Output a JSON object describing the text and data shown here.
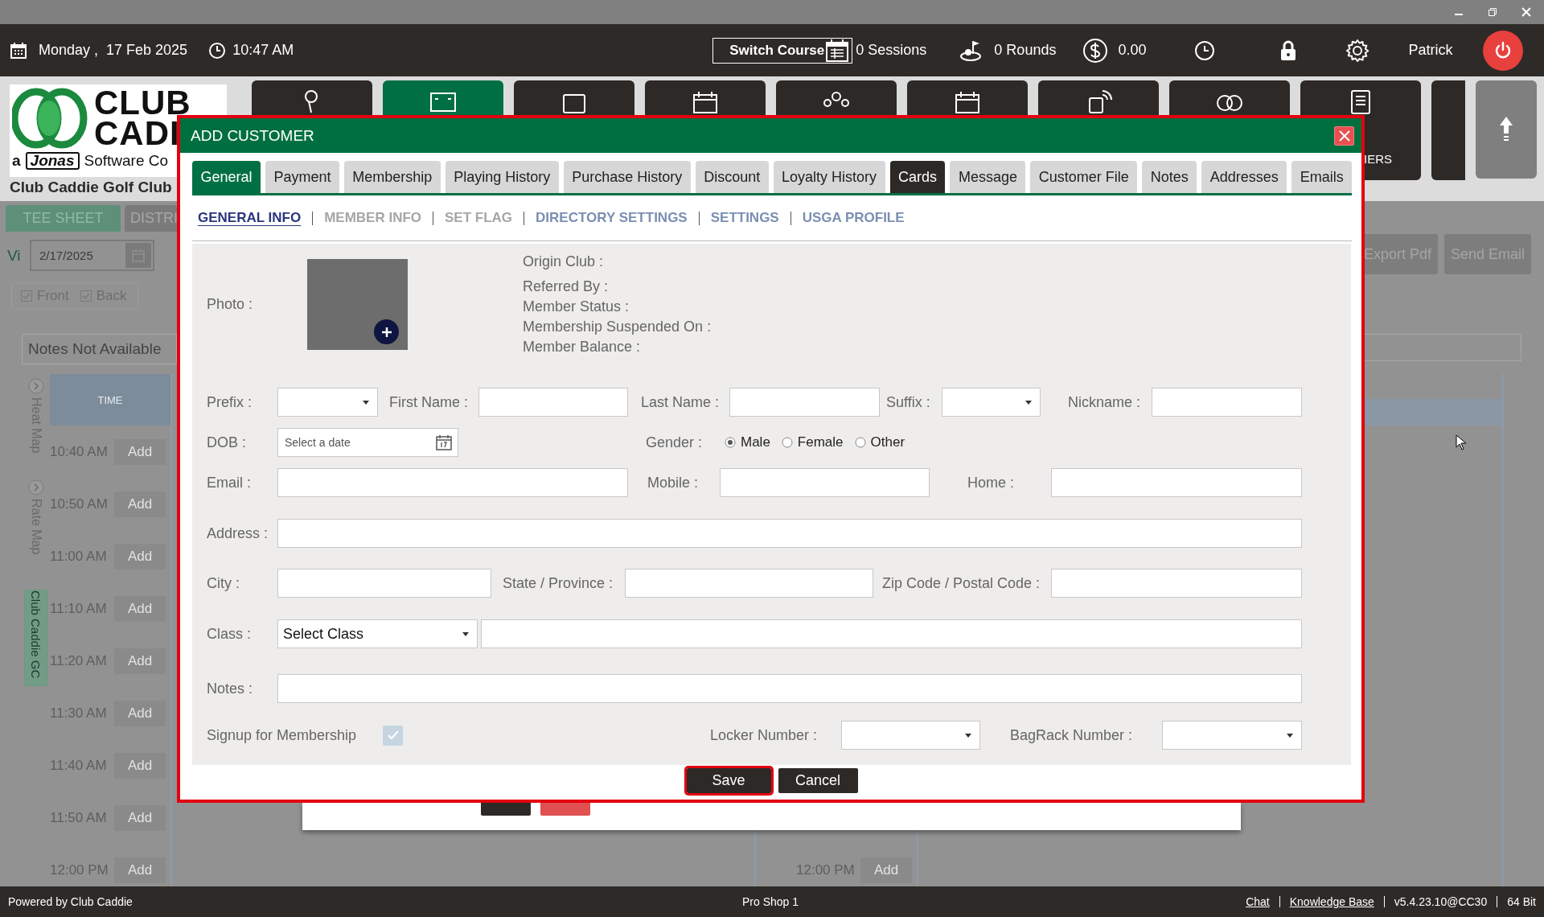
{
  "header": {
    "date_day": "Monday ,",
    "date": "17 Feb 2025",
    "time": "10:47 AM",
    "switch_course": "Switch Course",
    "sessions": "0 Sessions",
    "rounds": "0 Rounds",
    "balance": "0.00",
    "user": "Patrick"
  },
  "logo": {
    "line_1": "CLUB",
    "line_2": "CADI",
    "company_prefix": "a",
    "company_brand": "Jonas",
    "company_suffix": "Software Co",
    "club_name": "Club Caddie Golf Club"
  },
  "nav_tiles": [
    {
      "selected": false
    },
    {
      "selected": true
    },
    {
      "selected": false
    },
    {
      "selected": false
    },
    {
      "selected": false
    },
    {
      "selected": false
    },
    {
      "selected": false
    },
    {
      "selected": false
    },
    {
      "selected": false,
      "label": "IERS"
    }
  ],
  "tee_sheet": {
    "tabs": [
      {
        "label": "TEE SHEET",
        "selected": true
      },
      {
        "label": "DISTRI",
        "selected": false
      }
    ],
    "view_label": "Vi",
    "date": "2/17/2025",
    "filters": [
      {
        "label": "Front",
        "checked": true
      },
      {
        "label": "Back",
        "checked": true
      }
    ],
    "notes": "Notes Not Available",
    "side_tabs": [
      "Heat Map",
      "Rate Map"
    ],
    "course_label": "Club Caddie GC",
    "time_header": "TIME",
    "slots": [
      {
        "time": "10:40 AM",
        "action": "Add"
      },
      {
        "time": "10:50 AM",
        "action": "Add"
      },
      {
        "time": "11:00 AM",
        "action": "Add"
      },
      {
        "time": "11:10 AM",
        "action": "Add"
      },
      {
        "time": "11:20 AM",
        "action": "Add"
      },
      {
        "time": "11:30 AM",
        "action": "Add"
      },
      {
        "time": "11:40 AM",
        "action": "Add"
      },
      {
        "time": "11:50 AM",
        "action": "Add"
      },
      {
        "time": "12:00 PM",
        "action": "Add"
      }
    ],
    "column_2_slots": [
      {
        "time": "12:00 PM",
        "action": "Add"
      }
    ],
    "actions": [
      "Export Pdf",
      "Send Email"
    ]
  },
  "dialog": {
    "title": "ADD CUSTOMER",
    "tabs": [
      {
        "label": "General",
        "selected": true,
        "hovered": false
      },
      {
        "label": "Payment",
        "selected": false,
        "hovered": false
      },
      {
        "label": "Membership",
        "selected": false,
        "hovered": false
      },
      {
        "label": "Playing History",
        "selected": false,
        "hovered": false
      },
      {
        "label": "Purchase History",
        "selected": false,
        "hovered": false
      },
      {
        "label": "Discount",
        "selected": false,
        "hovered": false
      },
      {
        "label": "Loyalty History",
        "selected": false,
        "hovered": false
      },
      {
        "label": "Cards",
        "selected": false,
        "hovered": true
      },
      {
        "label": "Message",
        "selected": false,
        "hovered": false
      },
      {
        "label": "Customer File",
        "selected": false,
        "hovered": false
      },
      {
        "label": "Notes",
        "selected": false,
        "hovered": false
      },
      {
        "label": "Addresses",
        "selected": false,
        "hovered": false
      },
      {
        "label": "Emails",
        "selected": false,
        "hovered": false
      }
    ],
    "sections": [
      {
        "label": "GENERAL INFO",
        "selected": true,
        "disabled": false
      },
      {
        "label": "MEMBER INFO",
        "selected": false,
        "disabled": true
      },
      {
        "label": "SET FLAG",
        "selected": false,
        "disabled": true
      },
      {
        "label": "DIRECTORY SETTINGS",
        "selected": false,
        "disabled": false
      },
      {
        "label": "SETTINGS",
        "selected": false,
        "disabled": false
      },
      {
        "label": "USGA PROFILE",
        "selected": false,
        "disabled": false
      }
    ],
    "photo_label": "Photo :",
    "member_info": [
      "Origin Club :",
      "Referred By :",
      "Member Status :",
      "Membership Suspended On :",
      "Member Balance :"
    ],
    "rows": [
      {
        "fields": [
          {
            "kind": "select",
            "label": "Prefix :"
          },
          {
            "kind": "text",
            "label": "First Name :"
          },
          {
            "kind": "text",
            "label": "Last Name :"
          },
          {
            "kind": "select",
            "label": "Suffix :"
          },
          {
            "kind": "text",
            "label": "Nickname :"
          }
        ]
      },
      {
        "fields": [
          {
            "kind": "date",
            "label": "DOB :",
            "placeholder": "Select a date"
          },
          {
            "kind": "radio",
            "label": "Gender :",
            "options": [
              {
                "label": "Male",
                "selected": true
              },
              {
                "label": "Female",
                "selected": false
              },
              {
                "label": "Other",
                "selected": false
              }
            ]
          }
        ]
      },
      {
        "fields": [
          {
            "kind": "text",
            "label": "Email :"
          },
          {
            "kind": "text",
            "label": "Mobile :"
          },
          {
            "kind": "text",
            "label": "Home :"
          }
        ]
      },
      {
        "fields": [
          {
            "kind": "text",
            "label": "Address :"
          }
        ]
      },
      {
        "fields": [
          {
            "kind": "text",
            "label": "City :"
          },
          {
            "kind": "text",
            "label": "State / Province :"
          },
          {
            "kind": "text",
            "label": "Zip Code / Postal Code :"
          }
        ]
      },
      {
        "fields": [
          {
            "kind": "select",
            "label": "Class :",
            "value": "Select Class"
          },
          {
            "kind": "text"
          }
        ]
      },
      {
        "fields": [
          {
            "kind": "text",
            "label": "Notes :"
          }
        ]
      },
      {
        "fields": [
          {
            "kind": "checkbox",
            "label": "Signup for Membership",
            "checked": true,
            "disabled": true
          },
          {
            "kind": "select",
            "label": "Locker Number :"
          },
          {
            "kind": "select",
            "label": "BagRack Number :"
          }
        ]
      }
    ],
    "buttons": [
      {
        "label": "Save",
        "focused": true
      },
      {
        "label": "Cancel",
        "focused": false
      }
    ]
  },
  "status_bar": {
    "left": "Powered by Club Caddie",
    "center": "Pro Shop 1",
    "links": [
      "Chat",
      "Knowledge Base"
    ],
    "version": "v5.4.23.10@CC30",
    "arch": "64 Bit"
  }
}
